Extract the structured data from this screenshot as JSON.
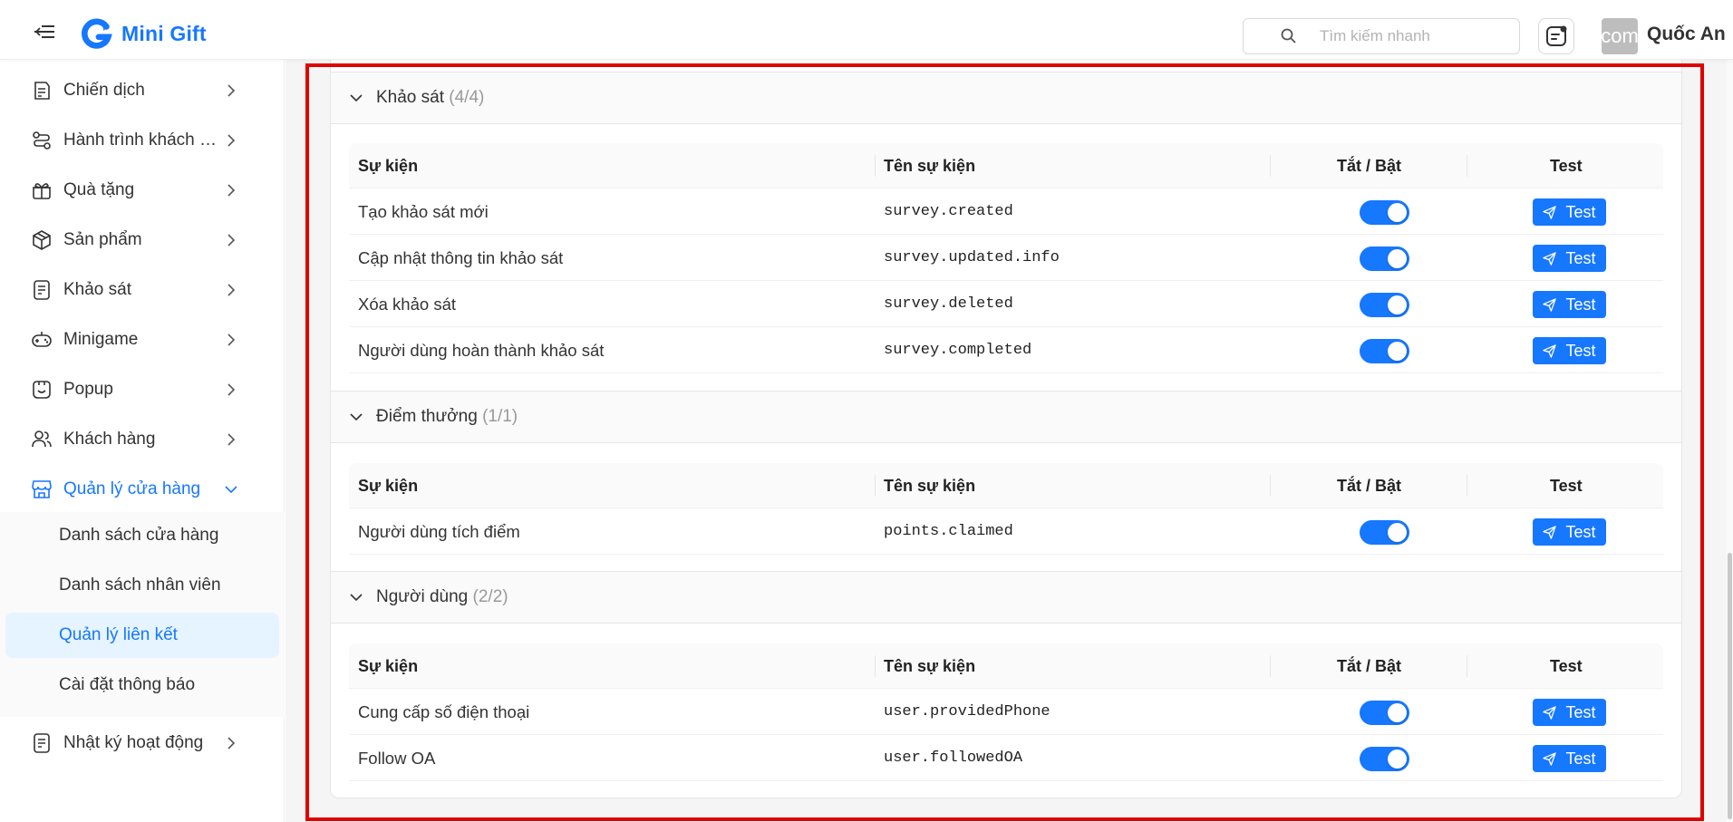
{
  "app": {
    "name": "Mini Gift"
  },
  "header": {
    "search_placeholder": "Tìm kiếm nhanh",
    "avatar_text": "com",
    "user_name": "Quốc An"
  },
  "sidebar": {
    "items": [
      {
        "label": "Chiến dịch",
        "icon": "campaign-icon"
      },
      {
        "label": "Hành trình khách hàng",
        "icon": "journey-icon"
      },
      {
        "label": "Quà tặng",
        "icon": "gift-icon"
      },
      {
        "label": "Sản phẩm",
        "icon": "product-box-icon"
      },
      {
        "label": "Khảo sát",
        "icon": "survey-icon"
      },
      {
        "label": "Minigame",
        "icon": "gamepad-icon"
      },
      {
        "label": "Popup",
        "icon": "popup-icon"
      },
      {
        "label": "Khách hàng",
        "icon": "customers-icon"
      },
      {
        "label": "Quản lý cửa hàng",
        "icon": "store-icon",
        "expanded": true
      },
      {
        "label": "Nhật ký hoạt động",
        "icon": "activity-log-icon"
      }
    ],
    "submenu": [
      {
        "label": "Danh sách cửa hàng"
      },
      {
        "label": "Danh sách nhân viên"
      },
      {
        "label": "Quản lý liên kết",
        "selected": true
      },
      {
        "label": "Cài đặt thông báo"
      }
    ]
  },
  "table_headers": {
    "event": "Sự kiện",
    "event_name": "Tên sự kiện",
    "toggle": "Tắt / Bật",
    "test": "Test"
  },
  "test_button_label": "Test",
  "panels": [
    {
      "title": "Khảo sát",
      "count": "(4/4)",
      "rows": [
        {
          "event": "Tạo khảo sát mới",
          "code": "survey.created",
          "enabled": true
        },
        {
          "event": "Cập nhật thông tin khảo sát",
          "code": "survey.updated.info",
          "enabled": true
        },
        {
          "event": "Xóa khảo sát",
          "code": "survey.deleted",
          "enabled": true
        },
        {
          "event": "Người dùng hoàn thành khảo sát",
          "code": "survey.completed",
          "enabled": true
        }
      ]
    },
    {
      "title": "Điểm thưởng",
      "count": "(1/1)",
      "rows": [
        {
          "event": "Người dùng tích điểm",
          "code": "points.claimed",
          "enabled": true
        }
      ]
    },
    {
      "title": "Người dùng",
      "count": "(2/2)",
      "rows": [
        {
          "event": "Cung cấp số điện thoại",
          "code": "user.providedPhone",
          "enabled": true
        },
        {
          "event": "Follow OA",
          "code": "user.followedOA",
          "enabled": true
        }
      ]
    }
  ],
  "colors": {
    "primary": "#1677ff",
    "highlight_border": "#e00000",
    "selected_bg": "#e6f4ff"
  }
}
